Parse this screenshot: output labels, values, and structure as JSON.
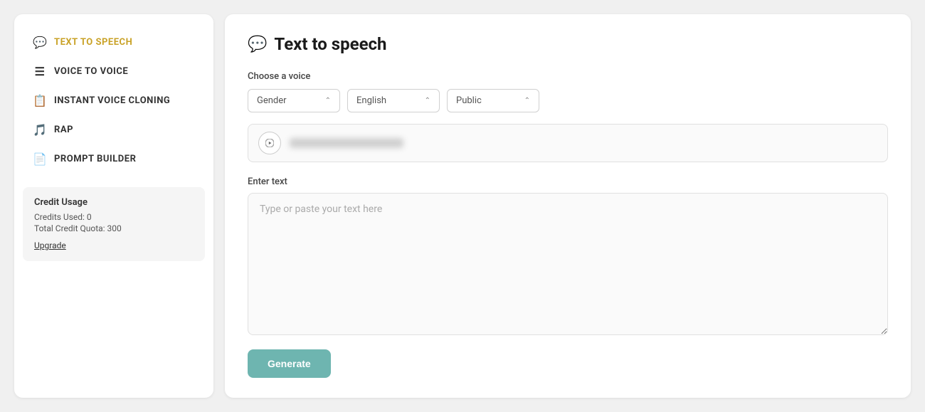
{
  "sidebar": {
    "items": [
      {
        "id": "text-to-speech",
        "label": "TEXT TO SPEECH",
        "icon": "💬",
        "active": true
      },
      {
        "id": "voice-to-voice",
        "label": "VOICE TO VOICE",
        "icon": "☰",
        "active": false
      },
      {
        "id": "instant-voice-cloning",
        "label": "INSTANT VOICE CLONING",
        "icon": "📋",
        "active": false
      },
      {
        "id": "rap",
        "label": "RAP",
        "icon": "🎵",
        "active": false
      },
      {
        "id": "prompt-builder",
        "label": "PROMPT BUILDER",
        "icon": "📄",
        "active": false
      }
    ],
    "credit_box": {
      "title": "Credit Usage",
      "credits_used_label": "Credits Used: 0",
      "total_quota_label": "Total Credit Quota: 300",
      "upgrade_label": "Upgrade"
    }
  },
  "main": {
    "header": {
      "icon": "💬",
      "title": "Text to speech"
    },
    "choose_voice_label": "Choose a voice",
    "filters": [
      {
        "label": "Gender",
        "value": "Gender"
      },
      {
        "label": "English",
        "value": "English"
      },
      {
        "label": "Public",
        "value": "Public"
      }
    ],
    "enter_text_label": "Enter text",
    "text_placeholder": "Type or paste your text here",
    "generate_button_label": "Generate"
  }
}
